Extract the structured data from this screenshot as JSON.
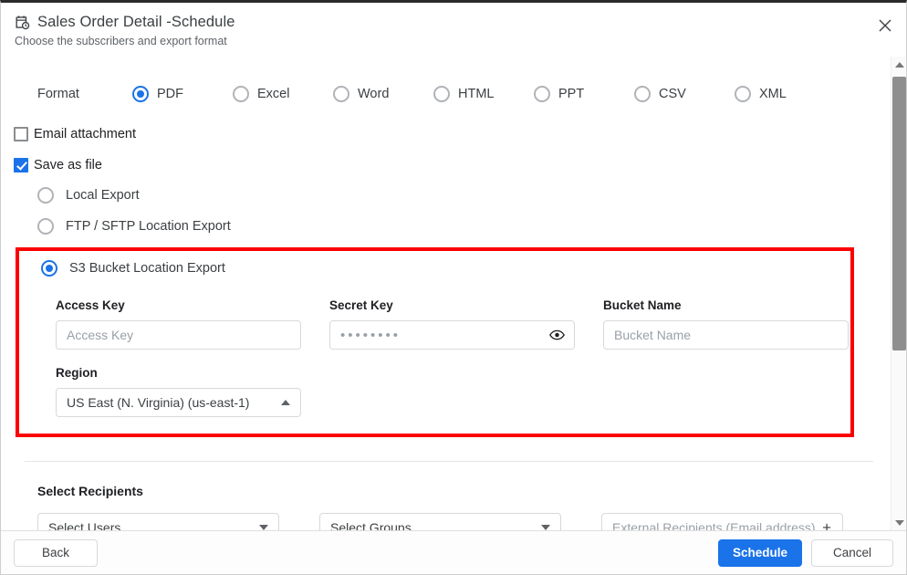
{
  "header": {
    "icon": "schedule-calendar-clock-icon",
    "title": "Sales Order Detail -Schedule",
    "subtitle": "Choose the subscribers and export format",
    "close_icon": "close-icon"
  },
  "format": {
    "label": "Format",
    "selected": "PDF",
    "options": [
      {
        "label": "PDF",
        "selected": true
      },
      {
        "label": "Excel",
        "selected": false
      },
      {
        "label": "Word",
        "selected": false
      },
      {
        "label": "HTML",
        "selected": false
      },
      {
        "label": "PPT",
        "selected": false
      },
      {
        "label": "CSV",
        "selected": false
      },
      {
        "label": "XML",
        "selected": false
      }
    ]
  },
  "delivery": {
    "email_attachment": {
      "label": "Email attachment",
      "checked": false
    },
    "save_as_file": {
      "label": "Save as file",
      "checked": true
    },
    "destinations": [
      {
        "label": "Local Export",
        "selected": false
      },
      {
        "label": "FTP / SFTP Location Export",
        "selected": false
      },
      {
        "label": "S3 Bucket Location Export",
        "selected": true
      }
    ]
  },
  "s3": {
    "highlight_color": "#fb0000",
    "access_key": {
      "label": "Access Key",
      "value": "",
      "placeholder": "Access Key"
    },
    "secret_key": {
      "label": "Secret Key",
      "value": "••••••••",
      "placeholder": "",
      "reveal_icon": "eye-icon"
    },
    "bucket_name": {
      "label": "Bucket Name",
      "value": "",
      "placeholder": "Bucket Name"
    },
    "region": {
      "label": "Region",
      "value": "US East (N. Virginia) (us-east-1)",
      "caret": "chevron-up-icon"
    }
  },
  "recipients": {
    "title": "Select Recipients",
    "users": {
      "value": "Select Users",
      "caret": "chevron-down-icon"
    },
    "groups": {
      "value": "Select Groups",
      "caret": "chevron-down-icon"
    },
    "external": {
      "placeholder": "External Recipients (Email address)",
      "add_icon": "plus-icon"
    }
  },
  "footer": {
    "back": "Back",
    "schedule": "Schedule",
    "cancel": "Cancel",
    "primary_color": "#1a73e8"
  }
}
